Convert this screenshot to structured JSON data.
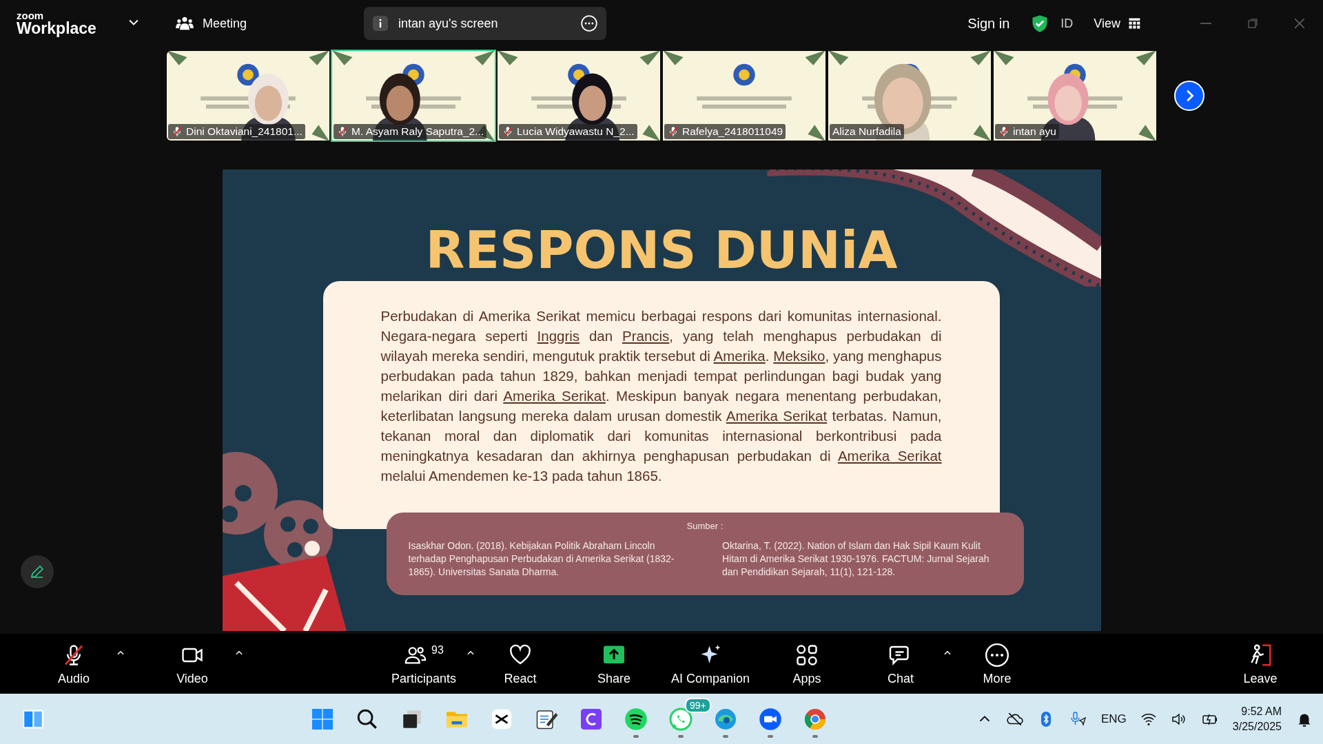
{
  "top_bar": {
    "logo_small": "zoom",
    "logo_large": "Workplace",
    "meeting_label": "Meeting",
    "screen_pill": "intan ayu's screen",
    "sign_in": "Sign in",
    "region": "ID",
    "view": "View"
  },
  "participants": [
    {
      "name": "Dini Oktaviani_241801...",
      "muted": true,
      "selected": false
    },
    {
      "name": "M. Asyam Raly Saputra_2...",
      "muted": true,
      "selected": true
    },
    {
      "name": "Lucia Widyawastu N_2...",
      "muted": true,
      "selected": false
    },
    {
      "name": "Rafelya_2418011049",
      "muted": true,
      "selected": false
    },
    {
      "name": "Aliza Nurfadila",
      "muted": false,
      "selected": false
    },
    {
      "name": "intan ayu",
      "muted": true,
      "selected": false
    }
  ],
  "slide": {
    "title": "RESPONS DUNiA",
    "paragraph": [
      {
        "kind": "text",
        "text": "Perbudakan di Amerika Serikat memicu berbagai respons dari komunitas internasional. Negara-negara seperti "
      },
      {
        "kind": "link",
        "text": "Inggris"
      },
      {
        "kind": "text",
        "text": " dan "
      },
      {
        "kind": "link",
        "text": "Prancis"
      },
      {
        "kind": "text",
        "text": ", yang telah menghapus perbudakan di wilayah mereka sendiri, mengutuk praktik tersebut di "
      },
      {
        "kind": "link",
        "text": "Amerika"
      },
      {
        "kind": "text",
        "text": ". "
      },
      {
        "kind": "link",
        "text": "Meksiko"
      },
      {
        "kind": "text",
        "text": ", yang menghapus perbudakan pada tahun 1829, bahkan menjadi tempat perlindungan bagi budak yang melarikan diri dari "
      },
      {
        "kind": "link",
        "text": "Amerika Serikat"
      },
      {
        "kind": "text",
        "text": ". Meskipun banyak negara menentang perbudakan, keterlibatan langsung mereka dalam urusan domestik "
      },
      {
        "kind": "link",
        "text": "Amerika Serikat"
      },
      {
        "kind": "text",
        "text": " terbatas. Namun, tekanan moral dan diplomatik dari komunitas internasional berkontribusi pada meningkatnya kesadaran dan akhirnya penghapusan perbudakan di "
      },
      {
        "kind": "link",
        "text": "Amerika Serikat"
      },
      {
        "kind": "text",
        "text": " melalui Amendemen ke-13 pada tahun 1865."
      }
    ],
    "sources_title": "Sumber :",
    "sources": [
      "Isaskhar Odon. (2018). Kebijakan Politik Abraham Lincoln terhadap Penghapusan Perbudakan di Amerika Serikat (1832-1865). Universitas Sanata Dharma.",
      "Oktarina, T. (2022). Nation of Islam dan Hak Sipil Kaum Kulit Hitam di Amerika Serikat 1930-1976. FACTUM: Jurnal Sejarah dan Pendidikan Sejarah, 11(1), 121-128."
    ]
  },
  "toolbar": [
    {
      "kind": "audio",
      "label": "Audio",
      "muted": true,
      "caret": true
    },
    {
      "kind": "video",
      "label": "Video",
      "caret": true
    },
    {
      "kind": "participants",
      "label": "Participants",
      "count": "93",
      "caret": true
    },
    {
      "kind": "react",
      "label": "React",
      "caret": false
    },
    {
      "kind": "share",
      "label": "Share",
      "caret": false
    },
    {
      "kind": "ai",
      "label": "AI Companion",
      "caret": false
    },
    {
      "kind": "apps",
      "label": "Apps",
      "caret": false
    },
    {
      "kind": "chat",
      "label": "Chat",
      "caret": true
    },
    {
      "kind": "more",
      "label": "More",
      "caret": false
    },
    {
      "kind": "leave",
      "label": "Leave",
      "caret": false
    }
  ],
  "taskbar": {
    "apps": [
      {
        "kind": "start",
        "running": false
      },
      {
        "kind": "search",
        "running": false
      },
      {
        "kind": "taskview",
        "running": false
      },
      {
        "kind": "files",
        "running": false
      },
      {
        "kind": "capcut",
        "running": false
      },
      {
        "kind": "notes",
        "running": false
      },
      {
        "kind": "canva",
        "running": false
      },
      {
        "kind": "spotify",
        "running": true
      },
      {
        "kind": "whatsapp",
        "running": true,
        "badge": "99+"
      },
      {
        "kind": "edge",
        "running": true
      },
      {
        "kind": "zoom",
        "running": true
      },
      {
        "kind": "chrome",
        "running": true
      }
    ],
    "language": "ENG",
    "time": "9:52 AM",
    "date": "3/25/2025"
  }
}
